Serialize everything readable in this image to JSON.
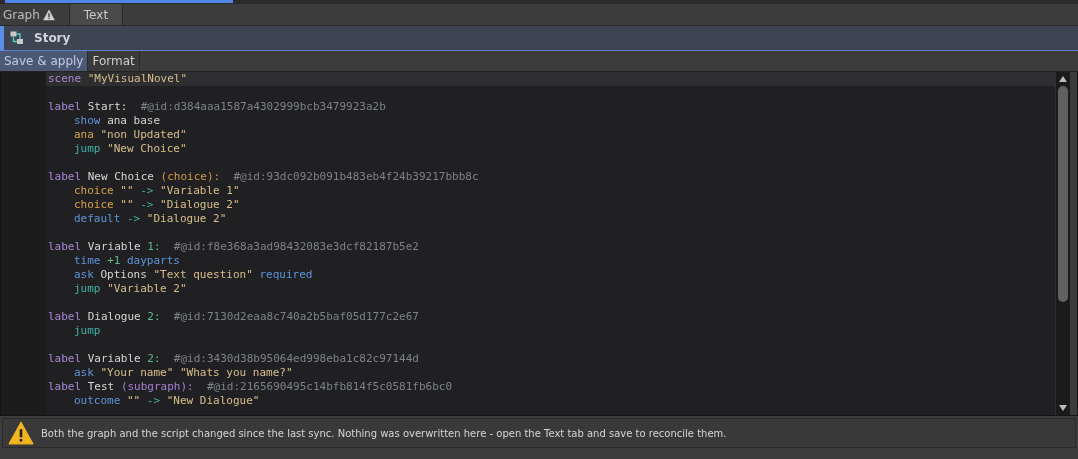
{
  "tabs": [
    {
      "label": "Graph",
      "warning": true,
      "selected": false
    },
    {
      "label": "Text",
      "warning": false,
      "selected": true
    }
  ],
  "panel": {
    "title": "Story"
  },
  "buttons": [
    {
      "label": "Save & apply",
      "selected": true
    },
    {
      "label": "Format",
      "selected": false
    }
  ],
  "editor": {
    "lines": [
      {
        "kind": "code",
        "indented": false,
        "current": true,
        "tokens": [
          {
            "kind": "keyword",
            "text": "scene "
          },
          {
            "kind": "string",
            "text": "\"MyVisualNovel\""
          }
        ]
      },
      {
        "kind": "blank"
      },
      {
        "kind": "code",
        "indented": false,
        "current": false,
        "tokens": [
          {
            "kind": "keyword",
            "text": "label "
          },
          {
            "kind": "ident",
            "text": "Start:  "
          },
          {
            "kind": "comment",
            "text": "#@id:d384aaa1587a4302999bcb3479923a2b"
          }
        ]
      },
      {
        "kind": "code",
        "indented": true,
        "current": false,
        "tokens": [
          {
            "kind": "command",
            "text": "show "
          },
          {
            "kind": "ident",
            "text": "ana base"
          }
        ]
      },
      {
        "kind": "code",
        "indented": true,
        "current": false,
        "tokens": [
          {
            "kind": "speaker",
            "text": "ana "
          },
          {
            "kind": "string",
            "text": "\"non Updated\""
          }
        ]
      },
      {
        "kind": "code",
        "indented": true,
        "current": false,
        "tokens": [
          {
            "kind": "jump",
            "text": "jump "
          },
          {
            "kind": "string",
            "text": "\"New Choice\""
          }
        ]
      },
      {
        "kind": "blank"
      },
      {
        "kind": "code",
        "indented": false,
        "current": false,
        "tokens": [
          {
            "kind": "keyword",
            "text": "label "
          },
          {
            "kind": "ident",
            "text": "New Choice "
          },
          {
            "kind": "tag",
            "text": "(choice):  "
          },
          {
            "kind": "comment",
            "text": "#@id:93dc092b091b483eb4f24b39217bbb8c"
          }
        ]
      },
      {
        "kind": "code",
        "indented": true,
        "current": false,
        "tokens": [
          {
            "kind": "speaker",
            "text": "choice "
          },
          {
            "kind": "string",
            "text": "\"\" "
          },
          {
            "kind": "arrow",
            "text": "-> "
          },
          {
            "kind": "string",
            "text": "\"Variable 1\""
          }
        ]
      },
      {
        "kind": "code",
        "indented": true,
        "current": false,
        "tokens": [
          {
            "kind": "speaker",
            "text": "choice "
          },
          {
            "kind": "string",
            "text": "\"\" "
          },
          {
            "kind": "arrow",
            "text": "-> "
          },
          {
            "kind": "string",
            "text": "\"Dialogue 2\""
          }
        ]
      },
      {
        "kind": "code",
        "indented": true,
        "current": false,
        "tokens": [
          {
            "kind": "command",
            "text": "default "
          },
          {
            "kind": "arrow",
            "text": "-> "
          },
          {
            "kind": "string",
            "text": "\"Dialogue 2\""
          }
        ]
      },
      {
        "kind": "blank"
      },
      {
        "kind": "code",
        "indented": false,
        "current": false,
        "tokens": [
          {
            "kind": "keyword",
            "text": "label "
          },
          {
            "kind": "ident",
            "text": "Variable "
          },
          {
            "kind": "number",
            "text": "1:  "
          },
          {
            "kind": "comment",
            "text": "#@id:f8e368a3ad98432083e3dcf82187b5e2"
          }
        ]
      },
      {
        "kind": "code",
        "indented": true,
        "current": false,
        "tokens": [
          {
            "kind": "command",
            "text": "time "
          },
          {
            "kind": "number",
            "text": "+1 "
          },
          {
            "kind": "command",
            "text": "dayparts"
          }
        ]
      },
      {
        "kind": "code",
        "indented": true,
        "current": false,
        "tokens": [
          {
            "kind": "command",
            "text": "ask "
          },
          {
            "kind": "ident",
            "text": "Options "
          },
          {
            "kind": "string",
            "text": "\"Text question\" "
          },
          {
            "kind": "command",
            "text": "required"
          }
        ]
      },
      {
        "kind": "code",
        "indented": true,
        "current": false,
        "tokens": [
          {
            "kind": "jump",
            "text": "jump "
          },
          {
            "kind": "string",
            "text": "\"Variable 2\""
          }
        ]
      },
      {
        "kind": "blank"
      },
      {
        "kind": "code",
        "indented": false,
        "current": false,
        "tokens": [
          {
            "kind": "keyword",
            "text": "label "
          },
          {
            "kind": "ident",
            "text": "Dialogue "
          },
          {
            "kind": "number",
            "text": "2:  "
          },
          {
            "kind": "comment",
            "text": "#@id:7130d2eaa8c740a2b5baf05d177c2e67"
          }
        ]
      },
      {
        "kind": "code",
        "indented": true,
        "current": false,
        "tokens": [
          {
            "kind": "jump",
            "text": "jump"
          }
        ]
      },
      {
        "kind": "blank"
      },
      {
        "kind": "code",
        "indented": false,
        "current": false,
        "tokens": [
          {
            "kind": "keyword",
            "text": "label "
          },
          {
            "kind": "ident",
            "text": "Variable "
          },
          {
            "kind": "number",
            "text": "2:  "
          },
          {
            "kind": "comment",
            "text": "#@id:3430d38b95064ed998eba1c82c97144d"
          }
        ]
      },
      {
        "kind": "code",
        "indented": true,
        "current": false,
        "tokens": [
          {
            "kind": "command",
            "text": "ask "
          },
          {
            "kind": "string",
            "text": "\"Your name\" \"Whats you name?\""
          }
        ]
      },
      {
        "kind": "code",
        "indented": false,
        "current": false,
        "tokens": [
          {
            "kind": "keyword",
            "text": "label "
          },
          {
            "kind": "ident",
            "text": "Test "
          },
          {
            "kind": "subtag",
            "text": "(subgraph):  "
          },
          {
            "kind": "comment",
            "text": "#@id:2165690495c14bfb814f5c0581fb6bc0"
          }
        ]
      },
      {
        "kind": "code",
        "indented": true,
        "current": false,
        "tokens": [
          {
            "kind": "command",
            "text": "outcome "
          },
          {
            "kind": "string",
            "text": "\"\" "
          },
          {
            "kind": "arrow",
            "text": "-> "
          },
          {
            "kind": "string",
            "text": "\"New Dialogue\""
          }
        ]
      }
    ]
  },
  "warning": {
    "text": "Both the graph and the script changed since the last sync. Nothing was overwritten here - open the Text tab and save to reconcile them."
  }
}
